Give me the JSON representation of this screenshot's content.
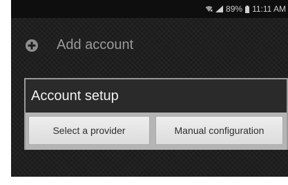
{
  "status_bar": {
    "icons": [
      "wifi-icon",
      "signal-icon",
      "battery-icon"
    ],
    "battery": "89%",
    "time": "11:11 AM"
  },
  "action_bar": {
    "icon": "add-circle-icon",
    "title": "Add account"
  },
  "panel": {
    "title": "Account setup",
    "buttons": [
      {
        "label": "Select a provider"
      },
      {
        "label": "Manual configuration"
      }
    ]
  },
  "colors": {
    "background": "#1c1c1c",
    "status_bar": "#0e0e0e",
    "panel": "#2a2a2a",
    "button_row": "#b5b5b5",
    "button": "#e6e6e6"
  }
}
